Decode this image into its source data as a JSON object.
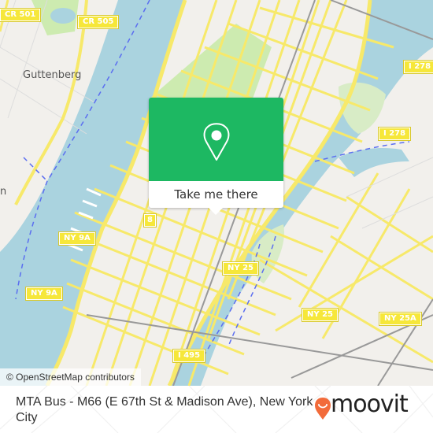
{
  "map": {
    "attribution": "© OpenStreetMap contributors",
    "place_labels": {
      "guttenberg": "Guttenberg",
      "partial_left": "n"
    },
    "road_shields": {
      "cr501": "CR 501",
      "cr505": "CR 505",
      "i278_top": "I 278",
      "i278_bottom": "I 278",
      "route8": "8",
      "ny9a_top": "NY 9A",
      "ny9a_bottom": "NY 9A",
      "ny25_left": "NY 25",
      "ny25_right": "NY 25",
      "ny25a": "NY 25A",
      "i495": "I 495"
    },
    "colors": {
      "water": "#aad3df",
      "land": "#f2f0ec",
      "park": "#cdebb0",
      "road": "#f7e96a",
      "shield": "#f6e73a",
      "popup_green": "#1db862",
      "moovit_orange": "#f26b3a"
    }
  },
  "popup": {
    "icon": "location-pin-icon",
    "button_label": "Take me there"
  },
  "footer": {
    "title": "MTA Bus - M66 (E 67th St & Madison Ave), New York City",
    "logo_text": "moovit"
  }
}
